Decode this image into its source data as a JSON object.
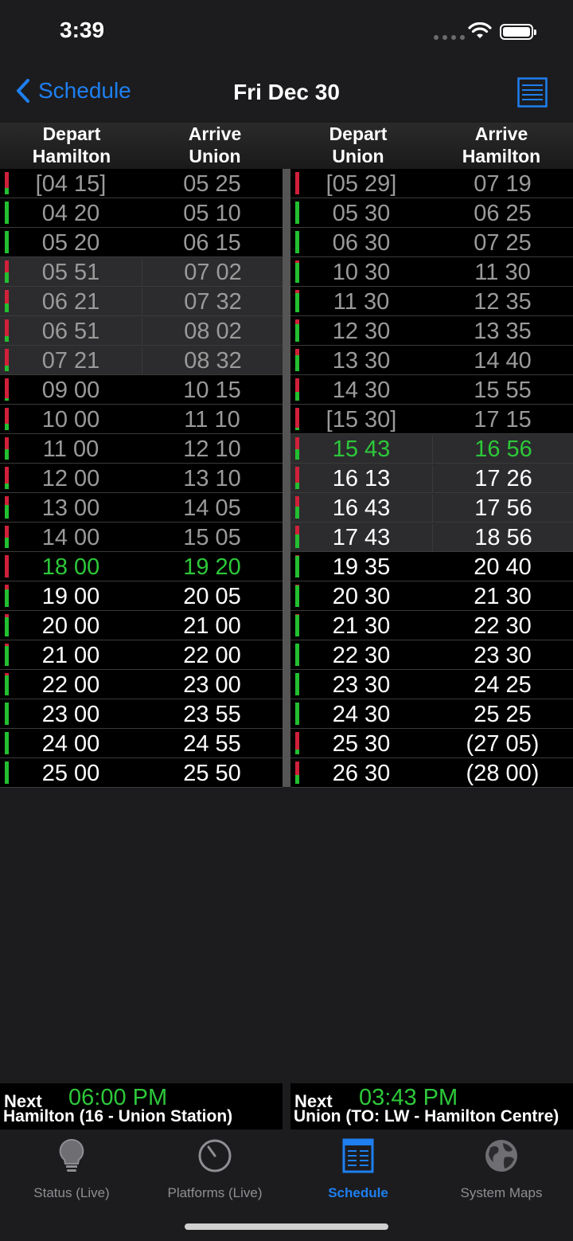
{
  "status": {
    "time": "3:39"
  },
  "nav": {
    "back_label": "Schedule",
    "title": "Fri Dec 30"
  },
  "headers": {
    "left_depart": [
      "Depart",
      "Hamilton"
    ],
    "left_arrive": [
      "Arrive",
      "Union"
    ],
    "right_depart": [
      "Depart",
      "Union"
    ],
    "right_arrive": [
      "Arrive",
      "Hamilton"
    ]
  },
  "left_rows": [
    {
      "depart": "[04 15]",
      "arrive": "05 25",
      "style": "dim",
      "bg": "black",
      "red": 0.7
    },
    {
      "depart": "04 20",
      "arrive": "05 10",
      "style": "dim",
      "bg": "black",
      "red": 0
    },
    {
      "depart": "05 20",
      "arrive": "06 15",
      "style": "dim",
      "bg": "black",
      "red": 0
    },
    {
      "depart": "05 51",
      "arrive": "07 02",
      "style": "dim",
      "bg": "grey",
      "red": 0.55
    },
    {
      "depart": "06 21",
      "arrive": "07 32",
      "style": "dim",
      "bg": "grey",
      "red": 0.6
    },
    {
      "depart": "06 51",
      "arrive": "08 02",
      "style": "dim",
      "bg": "grey",
      "red": 0.75
    },
    {
      "depart": "07 21",
      "arrive": "08 32",
      "style": "dim",
      "bg": "grey",
      "red": 0.75
    },
    {
      "depart": "09 00",
      "arrive": "10 15",
      "style": "dim",
      "bg": "black",
      "red": 0.9
    },
    {
      "depart": "10 00",
      "arrive": "11 10",
      "style": "dim",
      "bg": "black",
      "red": 0.7
    },
    {
      "depart": "11 00",
      "arrive": "12 10",
      "style": "dim",
      "bg": "black",
      "red": 0.55
    },
    {
      "depart": "12 00",
      "arrive": "13 10",
      "style": "dim",
      "bg": "black",
      "red": 0.75
    },
    {
      "depart": "13 00",
      "arrive": "14 05",
      "style": "dim",
      "bg": "black",
      "red": 0.4
    },
    {
      "depart": "14 00",
      "arrive": "15 05",
      "style": "dim",
      "bg": "black",
      "red": 0.55
    },
    {
      "depart": "18 00",
      "arrive": "19 20",
      "style": "live",
      "bg": "black",
      "red": 1
    },
    {
      "depart": "19 00",
      "arrive": "20 05",
      "style": "white",
      "bg": "black",
      "red": 0.2
    },
    {
      "depart": "20 00",
      "arrive": "21 00",
      "style": "white",
      "bg": "black",
      "red": 0.15
    },
    {
      "depart": "21 00",
      "arrive": "22 00",
      "style": "white",
      "bg": "black",
      "red": 0.1
    },
    {
      "depart": "22 00",
      "arrive": "23 00",
      "style": "white",
      "bg": "black",
      "red": 0.1
    },
    {
      "depart": "23 00",
      "arrive": "23 55",
      "style": "white",
      "bg": "black",
      "red": 0
    },
    {
      "depart": "24 00",
      "arrive": "24 55",
      "style": "white",
      "bg": "black",
      "red": 0
    },
    {
      "depart": "25 00",
      "arrive": "25 50",
      "style": "white",
      "bg": "black",
      "red": 0
    }
  ],
  "right_rows": [
    {
      "depart": "[05 29]",
      "arrive": "07 19",
      "style": "dim",
      "bg": "black",
      "red": 1
    },
    {
      "depart": "05 30",
      "arrive": "06 25",
      "style": "dim",
      "bg": "black",
      "red": 0
    },
    {
      "depart": "06 30",
      "arrive": "07 25",
      "style": "dim",
      "bg": "black",
      "red": 0
    },
    {
      "depart": "10 30",
      "arrive": "11 30",
      "style": "dim",
      "bg": "black",
      "red": 0.1
    },
    {
      "depart": "11 30",
      "arrive": "12 35",
      "style": "dim",
      "bg": "black",
      "red": 0.15
    },
    {
      "depart": "12 30",
      "arrive": "13 35",
      "style": "dim",
      "bg": "black",
      "red": 0.2
    },
    {
      "depart": "13 30",
      "arrive": "14 40",
      "style": "dim",
      "bg": "black",
      "red": 0.3
    },
    {
      "depart": "14 30",
      "arrive": "15 55",
      "style": "dim",
      "bg": "black",
      "red": 0.6
    },
    {
      "depart": "[15 30]",
      "arrive": "17 15",
      "style": "dim",
      "bg": "black",
      "red": 0.9
    },
    {
      "depart": "15 43",
      "arrive": "16 56",
      "style": "live",
      "bg": "grey",
      "red": 0.55
    },
    {
      "depart": "16 13",
      "arrive": "17 26",
      "style": "white",
      "bg": "grey",
      "red": 0.7
    },
    {
      "depart": "16 43",
      "arrive": "17 56",
      "style": "white",
      "bg": "grey",
      "red": 0.45
    },
    {
      "depart": "17 43",
      "arrive": "18 56",
      "style": "white",
      "bg": "grey",
      "red": 0.4
    },
    {
      "depart": "19 35",
      "arrive": "20 40",
      "style": "white",
      "bg": "black",
      "red": 0.05
    },
    {
      "depart": "20 30",
      "arrive": "21 30",
      "style": "white",
      "bg": "black",
      "red": 0.05
    },
    {
      "depart": "21 30",
      "arrive": "22 30",
      "style": "white",
      "bg": "black",
      "red": 0.05
    },
    {
      "depart": "22 30",
      "arrive": "23 30",
      "style": "white",
      "bg": "black",
      "red": 0
    },
    {
      "depart": "23 30",
      "arrive": "24 25",
      "style": "white",
      "bg": "black",
      "red": 0
    },
    {
      "depart": "24 30",
      "arrive": "25 25",
      "style": "white",
      "bg": "black",
      "red": 0
    },
    {
      "depart": "25 30",
      "arrive": "(27 05)",
      "style": "white",
      "bg": "black",
      "red": 0.8
    },
    {
      "depart": "26 30",
      "arrive": "(28 00)",
      "style": "white",
      "bg": "black",
      "red": 0.6
    }
  ],
  "next_left": {
    "label": "Next",
    "time": "06:00 PM",
    "dest": "Hamilton (16 - Union Station)"
  },
  "next_right": {
    "label": "Next",
    "time": "03:43 PM",
    "dest": "Union (TO: LW - Hamilton Centre)"
  },
  "tabs": [
    {
      "label": "Status (Live)",
      "icon": "lightbulb-icon",
      "active": false
    },
    {
      "label": "Platforms (Live)",
      "icon": "clock-icon",
      "active": false
    },
    {
      "label": "Schedule",
      "icon": "schedule-icon",
      "active": true
    },
    {
      "label": "System Maps",
      "icon": "globe-icon",
      "active": false
    }
  ],
  "colors": {
    "accent": "#1e7ff0",
    "live": "#2dc83a",
    "delay": "#d0203a"
  }
}
